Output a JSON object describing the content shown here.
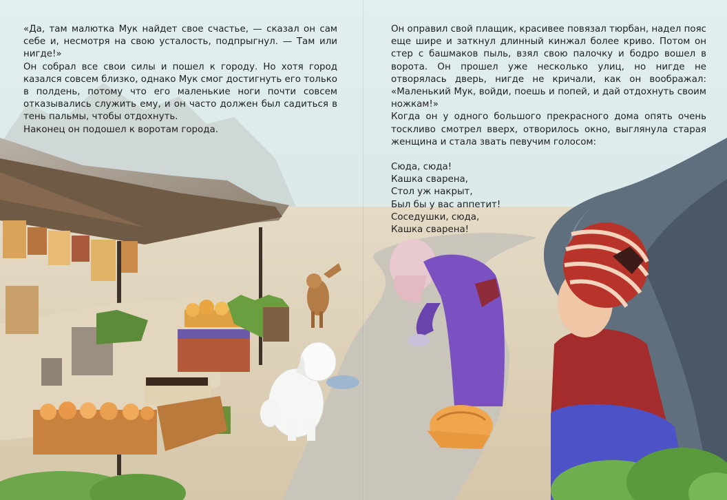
{
  "left_page": {
    "paragraphs": [
      "«Да, там малютка Мук найдет свое счастье, — сказал он сам себе и, несмотря на свою усталость, подпрыгнул. — Там или нигде!»",
      "Он собрал все свои силы и пошел к городу. Но хотя город казался совсем близко, однако Мук смог достигнуть его только в полдень, потому что его маленькие ноги почти совсем отказывались служить ему, и он часто должен был садиться в тень пальмы, чтобы отдохнуть.",
      "Наконец он подошел к воротам города."
    ]
  },
  "right_page": {
    "paragraphs": [
      "Он оправил свой плащик, красивее повязал тюрбан, надел пояс еще шире и заткнул длинный кинжал более криво. Потом он стер с башмаков пыль, взял свою палочку и бодро вошел в ворота. Он прошел уже несколько улиц, но нигде не отворялась дверь, нигде не кричали, как он воображал: «Маленький Мук, войди, поешь и попей, и дай отдохнуть своим ножкам!»",
      "Когда он у одного большого прекрасного дома опять очень тоскливо смотрел вверх, отворилось окно, выглянула старая женщина и стала звать певучим голосом:"
    ],
    "poem": [
      "Сюда, сюда!",
      "Кашка сварена,",
      "Стол уж накрыт,",
      "Был бы у вас аппетит!",
      "Соседушки, сюда,",
      "Кашка сварена!"
    ]
  },
  "colors": {
    "sky": "#d8e9ea",
    "road": "#c9c4ba",
    "sand": "#ddd0b6",
    "stall_wood": "#6f5a45",
    "woman_dress": "#7a4fc0",
    "boy_turban": "#b83a2a",
    "boy_pants": "#5556c8",
    "tree": "#5b6a76",
    "bush": "#6fae4f"
  }
}
